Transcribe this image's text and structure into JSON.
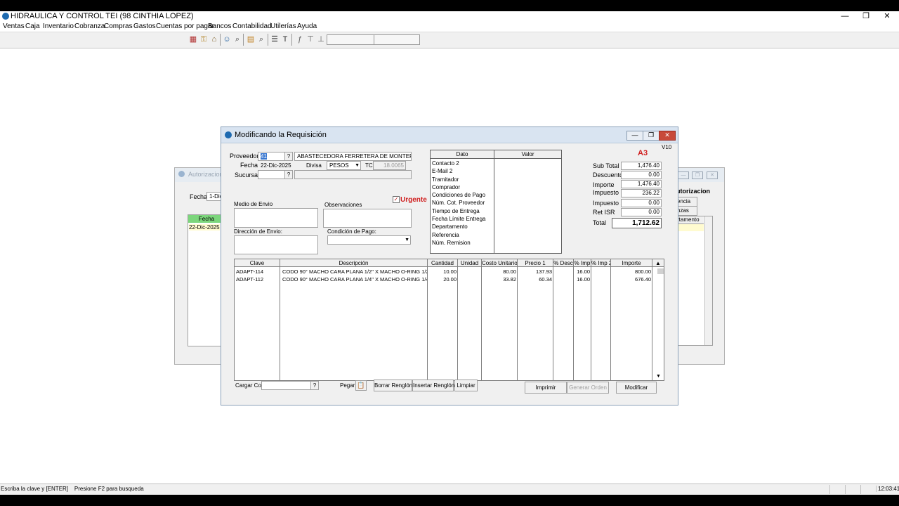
{
  "app": {
    "title": "HIDRAULICA Y CONTROL TEI  (98 CINTHIA LOPEZ)",
    "controls": {
      "minimize": "—",
      "restore": "❐",
      "close": "✕"
    }
  },
  "menu": [
    "Ventas",
    "Caja",
    "Inventario",
    "Cobranza",
    "Compras",
    "Gastos",
    "Cuentas por pagar",
    "Bancos",
    "Contabilidad",
    "Utilerías",
    "Ayuda"
  ],
  "background_windows": {
    "left": {
      "title": "Autorizacion",
      "fecha_label": "Fecha",
      "fecha_value": "1-Dic",
      "grid_header": "Fecha",
      "grid_row": "22-Dic-2025"
    },
    "right": {
      "title": "utorizacion",
      "tab1": "encia",
      "tab2": "nzas",
      "grid_header": "rtamento"
    }
  },
  "dialog": {
    "title": "Modificando la Requisición",
    "version": "V10",
    "badge": "A3",
    "proveedor_label": "Proveedor",
    "proveedor_code": "41",
    "proveedor_name": "ABASTECEDORA FERRETERA DE MONTERREY",
    "fecha_label": "Fecha",
    "fecha_value": "22-Dic-2025",
    "divisa_label": "Divisa",
    "divisa_value": "PESOS",
    "tc_label": "TC",
    "tc_value": "18.0065",
    "sucursal_label": "Sucursal",
    "sucursal_value": "",
    "urgente_label": "Urgente",
    "urgente_checked": true,
    "medio_envio_label": "Medio de Envio",
    "observaciones_label": "Observaciones",
    "direccion_envio_label": "Dirección de Envio:",
    "condicion_pago_label": "Condición de Pago:",
    "info_headers": {
      "dato": "Dato",
      "valor": "Valor"
    },
    "info_rows": [
      "Contacto 2",
      "E-Mail 2",
      "Tramitador",
      "Comprador",
      "Condiciones de Pago",
      "Núm. Cot. Proveedor",
      "Tiempo de Entrega",
      "Fecha Límite Entrega",
      "Departamento",
      "Referencia",
      "Núm. Remision"
    ],
    "totals": [
      {
        "label": "Sub Total",
        "value": "1,476.40"
      },
      {
        "label": "Descuento",
        "value": "0.00"
      },
      {
        "label": "Importe",
        "value": "1,476.40"
      },
      {
        "label": "Impuesto",
        "value": "236.22"
      },
      {
        "label": "Impuesto 2",
        "value": "0.00"
      },
      {
        "label": "Ret ISR",
        "value": "0.00"
      }
    ],
    "total": {
      "label": "Total",
      "value": "1,712.62"
    },
    "grid": {
      "headers": [
        "Clave",
        "Descripción",
        "Cantidad",
        "Unidad",
        "Costo Unitario",
        "Precio 1",
        "% Desc",
        "% Imp",
        "% Imp 2",
        "Importe"
      ],
      "rows": [
        {
          "clave": "ADAPT-114",
          "descripcion": "CODO 90° MACHO CARA PLANA 1/2\" X MACHO O-RING 1/2\" M",
          "cantidad": "10.00",
          "unidad": "",
          "costo": "80.00",
          "precio": "137.93",
          "desc": "",
          "imp": "16.00",
          "imp2": "",
          "importe": "800.00"
        },
        {
          "clave": "ADAPT-112",
          "descripcion": "CODO 90° MACHO CARA PLANA 1/4\" X MACHO O-RING 1/4\" M",
          "cantidad": "20.00",
          "unidad": "",
          "costo": "33.82",
          "precio": "60.34",
          "desc": "",
          "imp": "16.00",
          "imp2": "",
          "importe": "676.40"
        }
      ]
    },
    "cargar_cot_label": "Cargar Cot.",
    "pegar_label": "Pegar",
    "buttons": {
      "borrar": "Borrar Renglón",
      "insertar": "Insertar Renglón",
      "limpiar": "Limpiar",
      "imprimir": "Imprimir",
      "generar": "Generar Orden",
      "modificar": "Modificar"
    }
  },
  "status": {
    "hint": "Escriba la clave y [ENTER]    Presione F2 para busqueda",
    "time": "12:03:41"
  }
}
